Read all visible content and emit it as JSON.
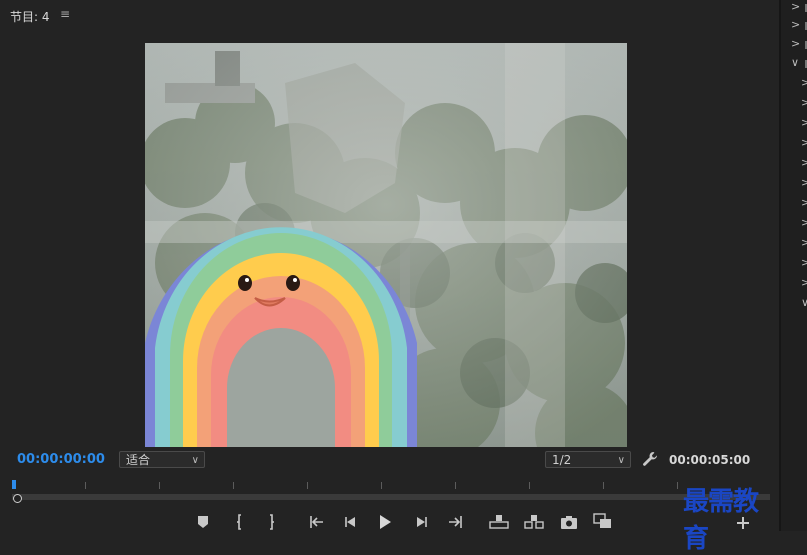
{
  "panel": {
    "title": "节目: 4",
    "menu_icon": "hamburger-icon"
  },
  "timecode": {
    "current": "00:00:00:00",
    "duration": "00:00:05:00"
  },
  "zoom": {
    "selected": "适合"
  },
  "resolution": {
    "selected": "1/2"
  },
  "colors": {
    "accent": "#2d8ceb",
    "background": "#232323",
    "watermark": "#1a46c4"
  },
  "controls": [
    {
      "name": "add-marker-button",
      "icon": "marker-icon"
    },
    {
      "name": "mark-in-button",
      "icon": "mark-in-icon"
    },
    {
      "name": "mark-out-button",
      "icon": "mark-out-icon"
    },
    {
      "name": "go-to-in-button",
      "icon": "go-to-in-icon"
    },
    {
      "name": "step-back-button",
      "icon": "step-back-icon"
    },
    {
      "name": "play-button",
      "icon": "play-icon"
    },
    {
      "name": "step-forward-button",
      "icon": "step-forward-icon"
    },
    {
      "name": "go-to-out-button",
      "icon": "go-to-out-icon"
    },
    {
      "name": "lift-button",
      "icon": "lift-icon"
    },
    {
      "name": "extract-button",
      "icon": "extract-icon"
    },
    {
      "name": "export-frame-button",
      "icon": "camera-icon"
    },
    {
      "name": "comparison-view-button",
      "icon": "comparison-icon"
    },
    {
      "name": "add-button",
      "icon": "plus-icon"
    }
  ],
  "watermark": {
    "text": "最需教育"
  },
  "side_panel": {
    "items": [
      ">",
      ">",
      ">",
      "∨",
      ">",
      ">",
      ">",
      ">",
      ">",
      ">",
      ">",
      ">",
      ">",
      ">",
      ">",
      "∨"
    ]
  }
}
